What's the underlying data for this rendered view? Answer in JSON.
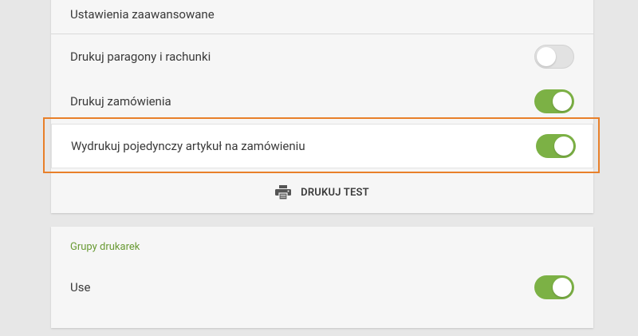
{
  "settings": {
    "advanced_label": "Ustawienia zaawansowane",
    "print_receipts": {
      "label": "Drukuj paragony i rachunki",
      "enabled": false
    },
    "print_orders": {
      "label": "Drukuj zamówienia",
      "enabled": true
    },
    "print_single_item": {
      "label": "Wydrukuj pojedynczy artykuł na zamówieniu",
      "enabled": true
    },
    "print_test_label": "DRUKUJ TEST"
  },
  "printer_groups": {
    "title": "Grupy drukarek",
    "use": {
      "label": "Use",
      "enabled": true
    }
  },
  "colors": {
    "toggle_on": "#7cb145",
    "toggle_off": "#e2e2e2",
    "section_title": "#6a9b35",
    "highlight": "#e8802a"
  },
  "icons": {
    "print_test": "printer-icon"
  }
}
